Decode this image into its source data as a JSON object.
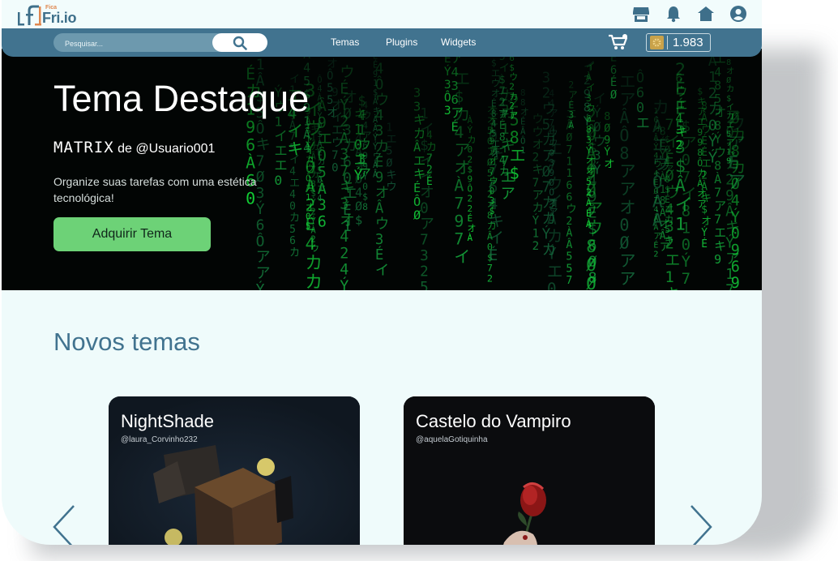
{
  "brand": {
    "small": "Fica",
    "name": "Fri.io"
  },
  "top_icons": [
    "store-icon",
    "bell-icon",
    "home-icon",
    "user-circle-icon"
  ],
  "nav": {
    "search_placeholder": "Pesquisar...",
    "links": [
      "Temas",
      "Plugins",
      "Widgets"
    ],
    "coins": "1.983"
  },
  "hero": {
    "title": "Tema Destaque",
    "theme_name": "MATRIX",
    "by": "de @Usuario001",
    "description": "Organize suas tarefas com uma estética tecnológica!",
    "button": "Adquirir Tema"
  },
  "section": {
    "title": "Novos temas"
  },
  "cards": [
    {
      "title": "NightShade",
      "author": "@laura_Corvinho232"
    },
    {
      "title": "Castelo do Vampiro",
      "author": "@aquelaGotiquinha"
    }
  ],
  "colors": {
    "primary": "#41738f",
    "accent": "#6dd277",
    "background": "#effbfb"
  }
}
